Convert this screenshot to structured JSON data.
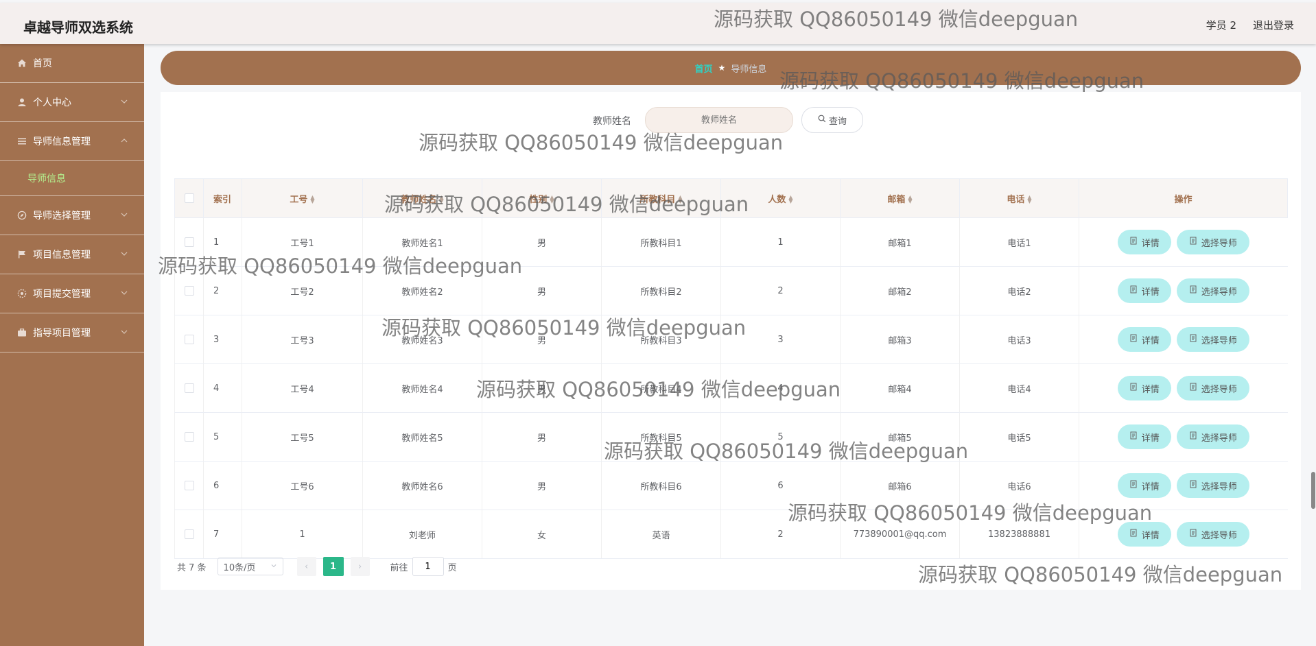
{
  "header": {
    "title": "卓越导师双选系统",
    "user": "学员 2",
    "logout": "退出登录"
  },
  "sidebar": {
    "items": [
      {
        "label": "首页",
        "icon": "home-icon"
      },
      {
        "label": "个人中心",
        "icon": "user-icon"
      },
      {
        "label": "导师信息管理",
        "icon": "list-icon",
        "expanded": true
      },
      {
        "label": "导师选择管理",
        "icon": "compass-icon"
      },
      {
        "label": "项目信息管理",
        "icon": "flag-icon"
      },
      {
        "label": "项目提交管理",
        "icon": "cog-icon"
      },
      {
        "label": "指导项目管理",
        "icon": "briefcase-icon"
      }
    ],
    "subitem": "导师信息"
  },
  "breadcrumb": {
    "home": "首页",
    "current": "导师信息"
  },
  "search": {
    "label": "教师姓名",
    "placeholder": "教师姓名",
    "button": "查询"
  },
  "table": {
    "headers": {
      "index": "索引",
      "job_no": "工号",
      "name": "教师姓名",
      "gender": "性别",
      "subject": "所教科目",
      "count": "人数",
      "email": "邮箱",
      "phone": "电话",
      "ops": "操作"
    },
    "detail_label": "详情",
    "choose_label": "选择导师",
    "rows": [
      {
        "index": "1",
        "job_no": "工号1",
        "name": "教师姓名1",
        "gender": "男",
        "subject": "所教科目1",
        "count": "1",
        "email": "邮箱1",
        "phone": "电话1"
      },
      {
        "index": "2",
        "job_no": "工号2",
        "name": "教师姓名2",
        "gender": "男",
        "subject": "所教科目2",
        "count": "2",
        "email": "邮箱2",
        "phone": "电话2"
      },
      {
        "index": "3",
        "job_no": "工号3",
        "name": "教师姓名3",
        "gender": "男",
        "subject": "所教科目3",
        "count": "3",
        "email": "邮箱3",
        "phone": "电话3"
      },
      {
        "index": "4",
        "job_no": "工号4",
        "name": "教师姓名4",
        "gender": "男",
        "subject": "所教科目4",
        "count": "4",
        "email": "邮箱4",
        "phone": "电话4"
      },
      {
        "index": "5",
        "job_no": "工号5",
        "name": "教师姓名5",
        "gender": "男",
        "subject": "所教科目5",
        "count": "5",
        "email": "邮箱5",
        "phone": "电话5"
      },
      {
        "index": "6",
        "job_no": "工号6",
        "name": "教师姓名6",
        "gender": "男",
        "subject": "所教科目6",
        "count": "6",
        "email": "邮箱6",
        "phone": "电话6"
      },
      {
        "index": "7",
        "job_no": "1",
        "name": "刘老师",
        "gender": "女",
        "subject": "英语",
        "count": "2",
        "email": "773890001@qq.com",
        "phone": "13823888881"
      }
    ]
  },
  "pagination": {
    "total": "共 7 条",
    "page_size": "10条/页",
    "current_page": "1",
    "goto_prefix": "前往",
    "goto_value": "1",
    "goto_suffix": "页"
  },
  "watermark": "源码获取 QQ86050149 微信deepguan",
  "colors": {
    "sidebar": "#a2714f",
    "accent": "#2bb789",
    "button": "#b5efef",
    "highlight": "#b4f18f"
  }
}
